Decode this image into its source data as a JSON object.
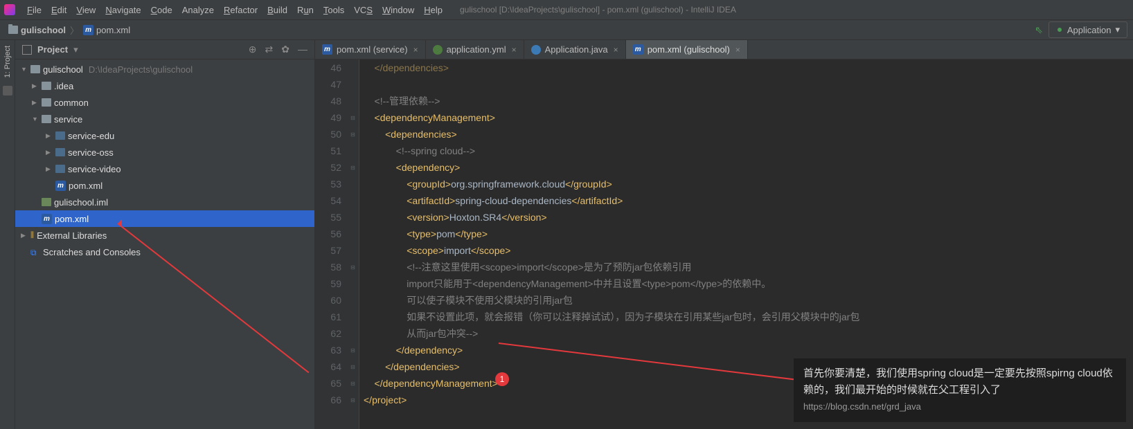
{
  "menu": {
    "items": [
      {
        "label": "File",
        "u": "F"
      },
      {
        "label": "Edit",
        "u": "E"
      },
      {
        "label": "View",
        "u": "V"
      },
      {
        "label": "Navigate",
        "u": "N"
      },
      {
        "label": "Code",
        "u": "C"
      },
      {
        "label": "Analyze",
        "u": null
      },
      {
        "label": "Refactor",
        "u": "R"
      },
      {
        "label": "Build",
        "u": "B"
      },
      {
        "label": "Run",
        "u": "u"
      },
      {
        "label": "Tools",
        "u": "T"
      },
      {
        "label": "VCS",
        "u": "S"
      },
      {
        "label": "Window",
        "u": "W"
      },
      {
        "label": "Help",
        "u": "H"
      }
    ],
    "title": "gulischool [D:\\IdeaProjects\\gulischool] - pom.xml (gulischool) - IntelliJ IDEA"
  },
  "breadcrumb": {
    "project": "gulischool",
    "file": "pom.xml"
  },
  "run_config": "Application",
  "sidebar_label": "1: Project",
  "panel_title": "Project",
  "tree": [
    {
      "depth": 0,
      "arrow": "▼",
      "icon": "fopen",
      "label": "gulischool",
      "dim": "D:\\IdeaProjects\\gulischool"
    },
    {
      "depth": 1,
      "arrow": "▶",
      "icon": "fopen",
      "label": ".idea"
    },
    {
      "depth": 1,
      "arrow": "▶",
      "icon": "fopen",
      "label": "common"
    },
    {
      "depth": 1,
      "arrow": "▼",
      "icon": "fopen",
      "label": "service"
    },
    {
      "depth": 2,
      "arrow": "▶",
      "icon": "fblue",
      "label": "service-edu"
    },
    {
      "depth": 2,
      "arrow": "▶",
      "icon": "fblue",
      "label": "service-oss"
    },
    {
      "depth": 2,
      "arrow": "▶",
      "icon": "fblue",
      "label": "service-video"
    },
    {
      "depth": 2,
      "arrow": "",
      "icon": "m",
      "label": "pom.xml"
    },
    {
      "depth": 1,
      "arrow": "",
      "icon": "file",
      "label": "gulischool.iml"
    },
    {
      "depth": 1,
      "arrow": "",
      "icon": "m",
      "label": "pom.xml",
      "selected": true
    },
    {
      "depth": 0,
      "arrow": "▶",
      "icon": "lib",
      "label": "External Libraries"
    },
    {
      "depth": 0,
      "arrow": "",
      "icon": "scratch",
      "label": "Scratches and Consoles"
    }
  ],
  "tabs": [
    {
      "icon": "m",
      "label": "pom.xml (service)",
      "active": false
    },
    {
      "icon": "yml",
      "label": "application.yml",
      "active": false
    },
    {
      "icon": "java",
      "label": "Application.java",
      "active": false
    },
    {
      "icon": "m",
      "label": "pom.xml (gulischool)",
      "active": true
    }
  ],
  "code": {
    "start": 46,
    "lines": [
      {
        "n": 46,
        "html": "    </dependencies>",
        "cls": "c-tag",
        "dim": true
      },
      {
        "n": 47,
        "html": ""
      },
      {
        "n": 48,
        "html": "    <!--管理依赖-->",
        "cls": "c-comment"
      },
      {
        "n": 49,
        "html": "    <dependencyManagement>",
        "cls": "c-tag"
      },
      {
        "n": 50,
        "html": "        <dependencies>",
        "cls": "c-tag"
      },
      {
        "n": 51,
        "html": "            <!--spring cloud-->",
        "cls": "c-comment"
      },
      {
        "n": 52,
        "html": "            <dependency>",
        "cls": "c-tag"
      },
      {
        "n": 53,
        "html": "                <groupId>org.springframework.cloud</groupId>",
        "mix": true
      },
      {
        "n": 54,
        "html": "                <artifactId>spring-cloud-dependencies</artifactId>",
        "mix": true
      },
      {
        "n": 55,
        "html": "                <version>Hoxton.SR4</version>",
        "mix": true
      },
      {
        "n": 56,
        "html": "                <type>pom</type>",
        "mix": true
      },
      {
        "n": 57,
        "html": "                <scope>import</scope>",
        "mix": true
      },
      {
        "n": 58,
        "html": "                <!--注意这里使用<scope>import</scope>是为了预防jar包依赖引用",
        "cls": "c-comment"
      },
      {
        "n": 59,
        "html": "                import只能用于<dependencyManagement>中并且设置<type>pom</type>的依赖中。",
        "cls": "c-comment"
      },
      {
        "n": 60,
        "html": "                可以使子模块不使用父模块的引用jar包",
        "cls": "c-comment"
      },
      {
        "n": 61,
        "html": "                如果不设置此项，就会报错（你可以注释掉试试），因为子模块在引用某些jar包时，会引用父模块中的jar包",
        "cls": "c-comment"
      },
      {
        "n": 62,
        "html": "                从而jar包冲突-->",
        "cls": "c-comment"
      },
      {
        "n": 63,
        "html": "            </dependency>",
        "cls": "c-tag"
      },
      {
        "n": 64,
        "html": "        </dependencies>",
        "cls": "c-tag"
      },
      {
        "n": 65,
        "html": "    </dependencyManagement>",
        "cls": "c-tag"
      },
      {
        "n": 66,
        "html": "</project>",
        "cls": "c-tag"
      }
    ]
  },
  "annotation": {
    "badge": "1",
    "text": "首先你要清楚，我们使用spring cloud是一定要先按照spirng cloud依赖的，我们最开始的时候就在父工程引入了",
    "url": "https://blog.csdn.net/grd_java"
  }
}
